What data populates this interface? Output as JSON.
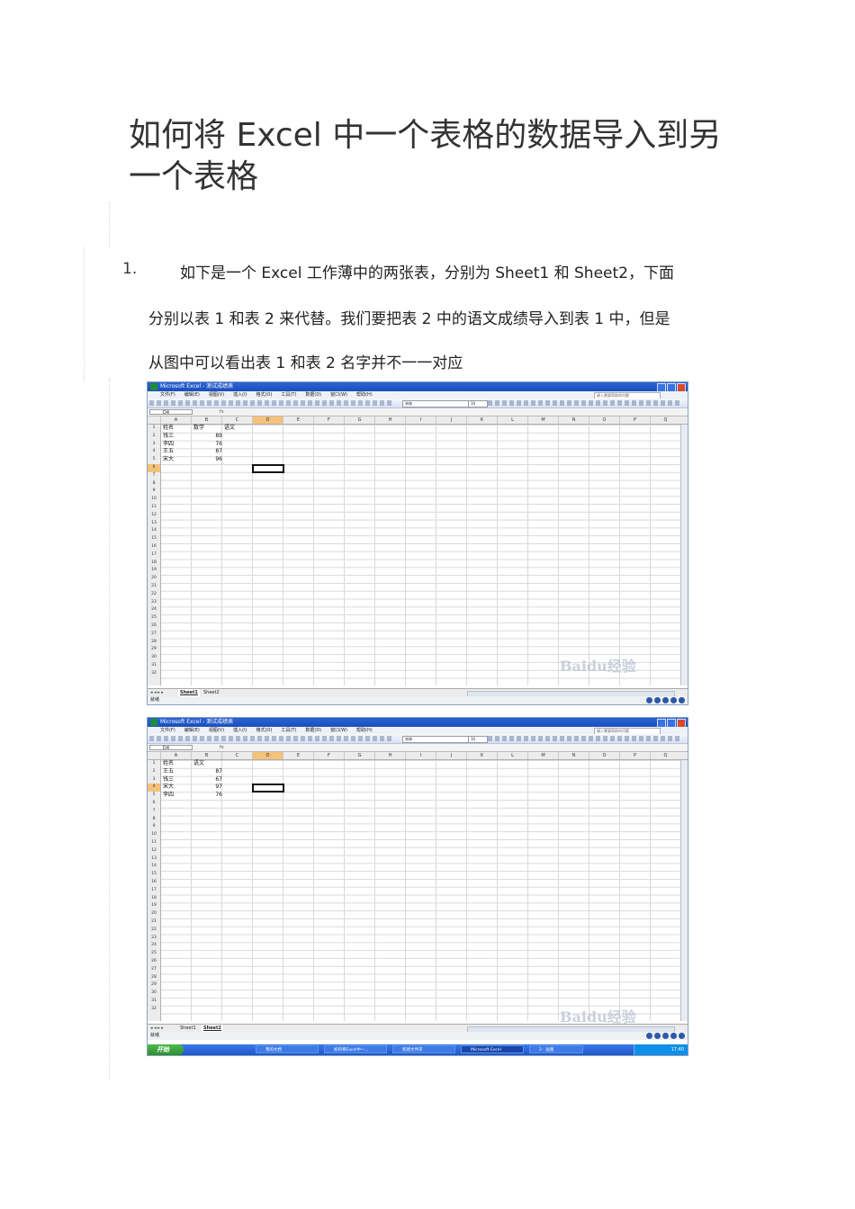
{
  "title_line1": "如何将 Excel 中一个表格的数据导入到另",
  "title_line2": "一个表格",
  "step_number": "1.",
  "step_text": {
    "line1": "如下是一个 Excel 工作薄中的两张表，分别为 Sheet1 和 Sheet2，下面",
    "line2": "分别以表 1 和表 2 来代替。我们要把表 2 中的语文成绩导入到表 1 中，但是",
    "line3": "从图中可以看出表 1 和表 2 名字并不一一对应"
  },
  "excel": {
    "window_title": "Microsoft Excel - 测试成绩表",
    "menus": [
      "文件(F)",
      "编辑(E)",
      "视图(V)",
      "插入(I)",
      "格式(O)",
      "工具(T)",
      "数据(D)",
      "窗口(W)",
      "帮助(H)"
    ],
    "help_placeholder": "键入需要帮助的问题",
    "font_name": "宋体",
    "font_size": "10",
    "name_box": "D4",
    "fx_label": "fx",
    "columns": [
      "A",
      "B",
      "C",
      "D",
      "E",
      "F",
      "G",
      "H",
      "I",
      "J",
      "K",
      "L",
      "M",
      "N",
      "O",
      "P",
      "Q"
    ],
    "status": "就绪",
    "watermark": "Baidu经验"
  },
  "sheet1": {
    "headers": [
      "姓名",
      "数学",
      "语文"
    ],
    "names": [
      "钱三",
      "李四",
      "王五",
      "宋大"
    ],
    "scores": [
      "89",
      "76",
      "87",
      "96"
    ],
    "tab_active": "Sheet1",
    "tab_other": "Sheet2"
  },
  "sheet2": {
    "headers": [
      "姓名",
      "语文"
    ],
    "names": [
      "王五",
      "钱三",
      "宋大",
      "李四"
    ],
    "scores": [
      "87",
      "67",
      "97",
      "76"
    ],
    "tab_other": "Sheet1",
    "tab_active": "Sheet2"
  },
  "taskbar": {
    "start": "开始",
    "items": [
      "我的文档",
      "如何将Excel中一...",
      "新建文件夹",
      "Microsoft Excel",
      "2 - 画图"
    ],
    "time": "17:40"
  }
}
